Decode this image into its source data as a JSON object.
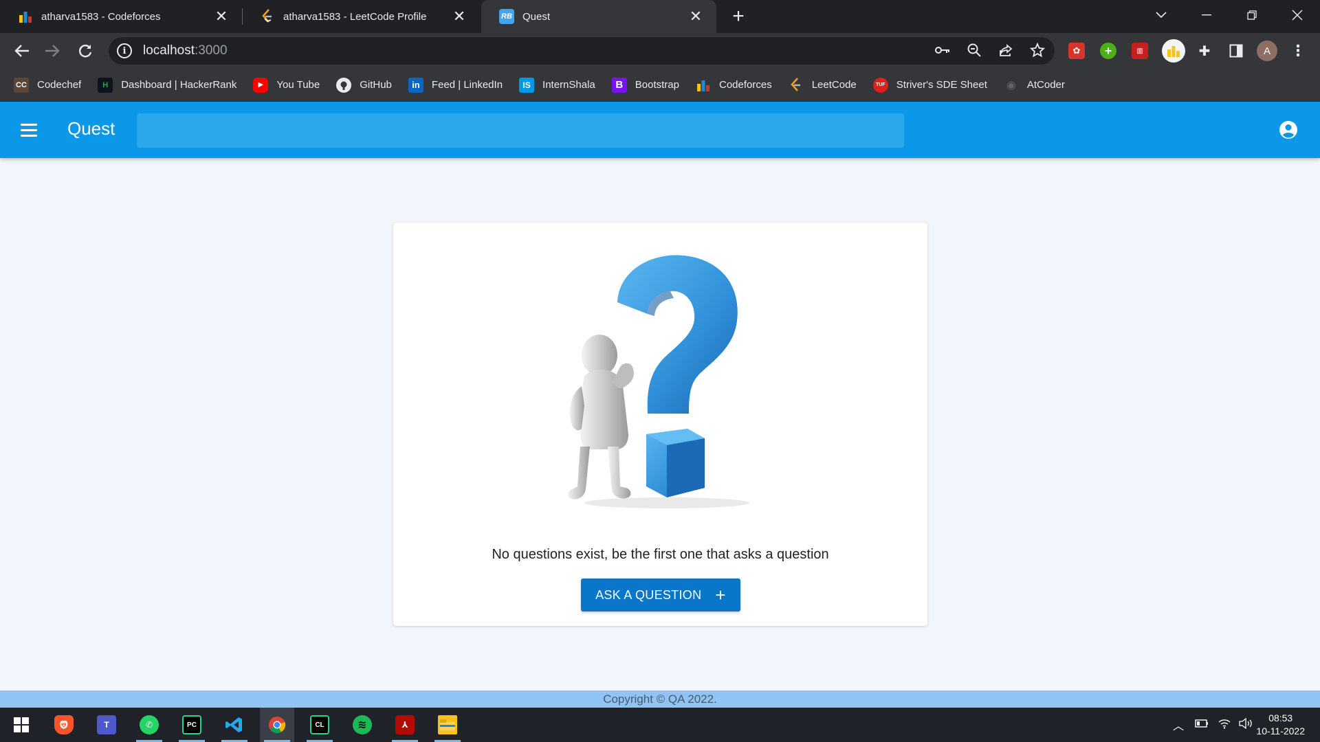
{
  "browser": {
    "tabs": [
      {
        "title": "atharva1583 - Codeforces",
        "favicon": "codeforces-icon",
        "active": false
      },
      {
        "title": "atharva1583 - LeetCode Profile",
        "favicon": "leetcode-icon",
        "active": false
      },
      {
        "title": "Quest",
        "favicon": "react-bootstrap-icon",
        "favicon_text": "RB",
        "active": true
      }
    ],
    "close_glyph": "✕",
    "url": {
      "host": "localhost",
      "port": ":3000"
    },
    "bookmarks": [
      {
        "label": "Codechef",
        "icon": "codechef-icon",
        "icon_text": "CC",
        "color": "#5b4638"
      },
      {
        "label": "Dashboard | HackerRank",
        "icon": "hackerrank-icon",
        "icon_text": "H",
        "color": "#1ba94c"
      },
      {
        "label": "You Tube",
        "icon": "youtube-icon",
        "icon_text": "▶",
        "color": "#ff0000"
      },
      {
        "label": "GitHub",
        "icon": "github-icon",
        "icon_text": "●",
        "color": "#24292e"
      },
      {
        "label": "Feed | LinkedIn",
        "icon": "linkedin-icon",
        "icon_text": "in",
        "color": "#0a66c2"
      },
      {
        "label": "InternShala",
        "icon": "internshala-icon",
        "icon_text": "IS",
        "color": "#0099e6"
      },
      {
        "label": "Bootstrap",
        "icon": "bootstrap-icon",
        "icon_text": "B",
        "color": "#7a12f2"
      },
      {
        "label": "Codeforces",
        "icon": "codeforces-icon",
        "icon_text": "▮",
        "color": "#35363a"
      },
      {
        "label": "LeetCode",
        "icon": "leetcode-icon",
        "icon_text": "≶",
        "color": "#35363a"
      },
      {
        "label": "Striver's SDE Sheet",
        "icon": "tuf-icon",
        "icon_text": "TUF",
        "color": "#e0201b"
      },
      {
        "label": "AtCoder",
        "icon": "atcoder-icon",
        "icon_text": "◉",
        "color": "#35363a"
      }
    ],
    "profile_initial": "A"
  },
  "app": {
    "brand": "Quest",
    "search": {
      "value": "",
      "placeholder": ""
    },
    "empty_state": {
      "message": "No questions exist, be the first one that asks a question",
      "button_label": "ASK A QUESTION",
      "button_icon": "+"
    },
    "footer": "Copyright © QA 2022."
  },
  "taskbar": {
    "apps": [
      "windows-start-icon",
      "brave-icon",
      "teams-icon",
      "whatsapp-icon",
      "pycharm-icon",
      "vscode-icon",
      "chrome-icon",
      "clion-icon",
      "spotify-icon",
      "acrobat-icon",
      "file-explorer-icon"
    ],
    "time": "08:53",
    "date": "10-11-2022"
  },
  "colors": {
    "appbar": "#0b98e8",
    "search_bg": "#29a8eb",
    "primary_button": "#0a76c9",
    "page_bg": "#f1f5fc",
    "footer_bg": "#91c4f6"
  }
}
